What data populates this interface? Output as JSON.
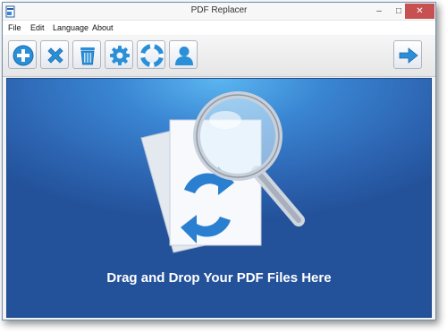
{
  "window": {
    "title": "PDF Replacer",
    "controls": {
      "minimize": "–",
      "maximize": "□",
      "close": "✕"
    }
  },
  "menu": [
    "File",
    "Edit",
    "Language",
    "About"
  ],
  "toolbar": {
    "buttons": [
      {
        "name": "add-button",
        "icon": "plus-circle-icon"
      },
      {
        "name": "remove-button",
        "icon": "x-icon"
      },
      {
        "name": "clear-button",
        "icon": "trash-icon"
      },
      {
        "name": "settings-button",
        "icon": "gear-icon"
      },
      {
        "name": "help-button",
        "icon": "lifebuoy-icon"
      },
      {
        "name": "account-button",
        "icon": "person-icon"
      }
    ],
    "next_button_icon": "arrow-right-icon"
  },
  "dropzone": {
    "text": "Drag and Drop Your PDF Files Here"
  },
  "colors": {
    "accent": "#2a8fd8",
    "dropzone_bg": "#2c63b0",
    "close_button": "#c75050"
  }
}
